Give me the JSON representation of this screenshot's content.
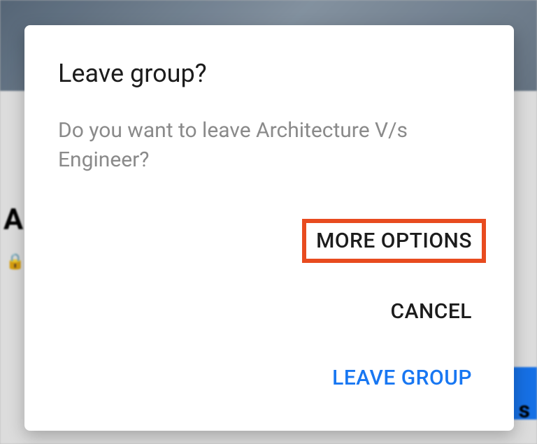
{
  "background": {
    "title_fragment": "A",
    "trailing_fragment": "s",
    "lock_glyph": "🔒"
  },
  "dialog": {
    "title": "Leave group?",
    "message": "Do you want to leave Architecture V/s Engineer?",
    "actions": {
      "more_options": "MORE OPTIONS",
      "cancel": "CANCEL",
      "leave": "LEAVE GROUP"
    }
  }
}
